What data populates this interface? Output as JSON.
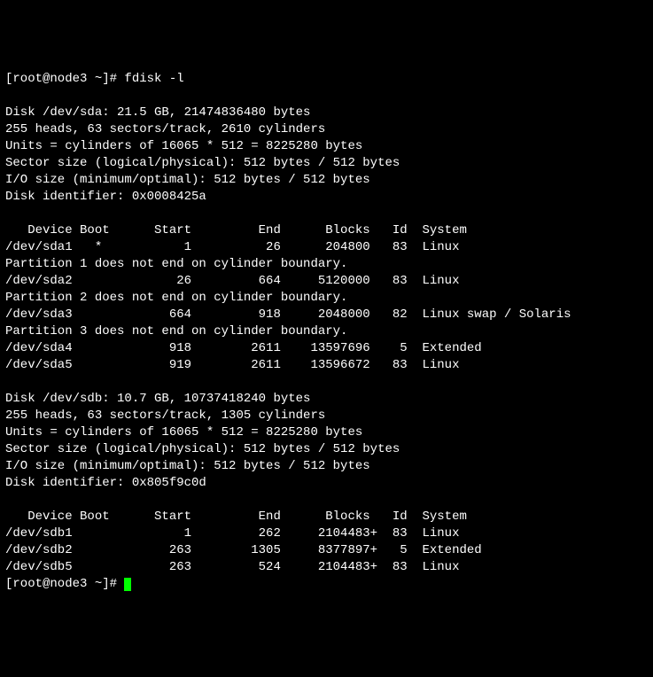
{
  "prompt1": "[root@node3 ~]# ",
  "cmd": "fdisk -l",
  "blank": "",
  "sda": {
    "hdr": "Disk /dev/sda: 21.5 GB, 21474836480 bytes",
    "geom": "255 heads, 63 sectors/track, 2610 cylinders",
    "units": "Units = cylinders of 16065 * 512 = 8225280 bytes",
    "ssize": "Sector size (logical/physical): 512 bytes / 512 bytes",
    "iosize": "I/O size (minimum/optimal): 512 bytes / 512 bytes",
    "ident": "Disk identifier: 0x0008425a",
    "cols": "   Device Boot      Start         End      Blocks   Id  System",
    "p1": "/dev/sda1   *           1          26      204800   83  Linux",
    "w1": "Partition 1 does not end on cylinder boundary.",
    "p2": "/dev/sda2              26         664     5120000   83  Linux",
    "w2": "Partition 2 does not end on cylinder boundary.",
    "p3": "/dev/sda3             664         918     2048000   82  Linux swap / Solaris",
    "w3": "Partition 3 does not end on cylinder boundary.",
    "p4": "/dev/sda4             918        2611    13597696    5  Extended",
    "p5": "/dev/sda5             919        2611    13596672   83  Linux"
  },
  "sdb": {
    "hdr": "Disk /dev/sdb: 10.7 GB, 10737418240 bytes",
    "geom": "255 heads, 63 sectors/track, 1305 cylinders",
    "units": "Units = cylinders of 16065 * 512 = 8225280 bytes",
    "ssize": "Sector size (logical/physical): 512 bytes / 512 bytes",
    "iosize": "I/O size (minimum/optimal): 512 bytes / 512 bytes",
    "ident": "Disk identifier: 0x805f9c0d",
    "cols": "   Device Boot      Start         End      Blocks   Id  System",
    "p1": "/dev/sdb1               1         262     2104483+  83  Linux",
    "p2": "/dev/sdb2             263        1305     8377897+   5  Extended",
    "p5": "/dev/sdb5             263         524     2104483+  83  Linux"
  },
  "prompt2": "[root@node3 ~]# "
}
